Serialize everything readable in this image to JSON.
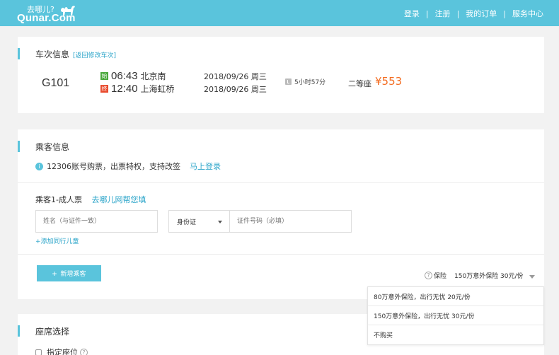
{
  "brand": {
    "name_cn": "去哪儿?",
    "name_en": "Qunar.Com"
  },
  "topnav": {
    "login": "登录",
    "register": "注册",
    "orders": "我的订单",
    "service": "服务中心",
    "separator": "|"
  },
  "train": {
    "section_title": "车次信息",
    "edit_link": "[返回修改车次]",
    "number": "G101",
    "depart": {
      "tag": "始",
      "time": "06:43",
      "station": "北京南",
      "date": "2018/09/26 周三"
    },
    "arrive": {
      "tag": "终",
      "time": "12:40",
      "station": "上海虹桥",
      "date": "2018/09/26 周三"
    },
    "duration": "5小时57分",
    "seat_class": "二等座",
    "price": "¥553"
  },
  "passenger": {
    "section_title": "乘客信息",
    "notice_icon": "i",
    "notice": "12306账号购票，出票特权，支持改签",
    "login_link": "马上登录",
    "pax_label": "乘客1-成人票",
    "help_link": "去哪儿网帮您填",
    "name_placeholder": "姓名（与证件一致）",
    "id_type": "身份证",
    "id_placeholder": "证件号码（必填）",
    "add_child": "+添加同行儿童",
    "add_passenger": "新增乘客",
    "add_passenger_icon": "+"
  },
  "insurance": {
    "help_icon": "?",
    "label": "保险",
    "selected": "150万意外保险 30元/份",
    "options": [
      "80万意外保险，出行无忧 20元/份",
      "150万意外保险，出行无忧 30元/份",
      "不购买"
    ]
  },
  "seat": {
    "section_title": "座席选择",
    "choose_seat": "指定座位",
    "help_icon": "?"
  },
  "colors": {
    "brand": "#5ac4dc",
    "price": "#f36c21",
    "link": "#2aa4c9",
    "start_tag": "#4aa83c",
    "end_tag": "#e94b2e"
  }
}
